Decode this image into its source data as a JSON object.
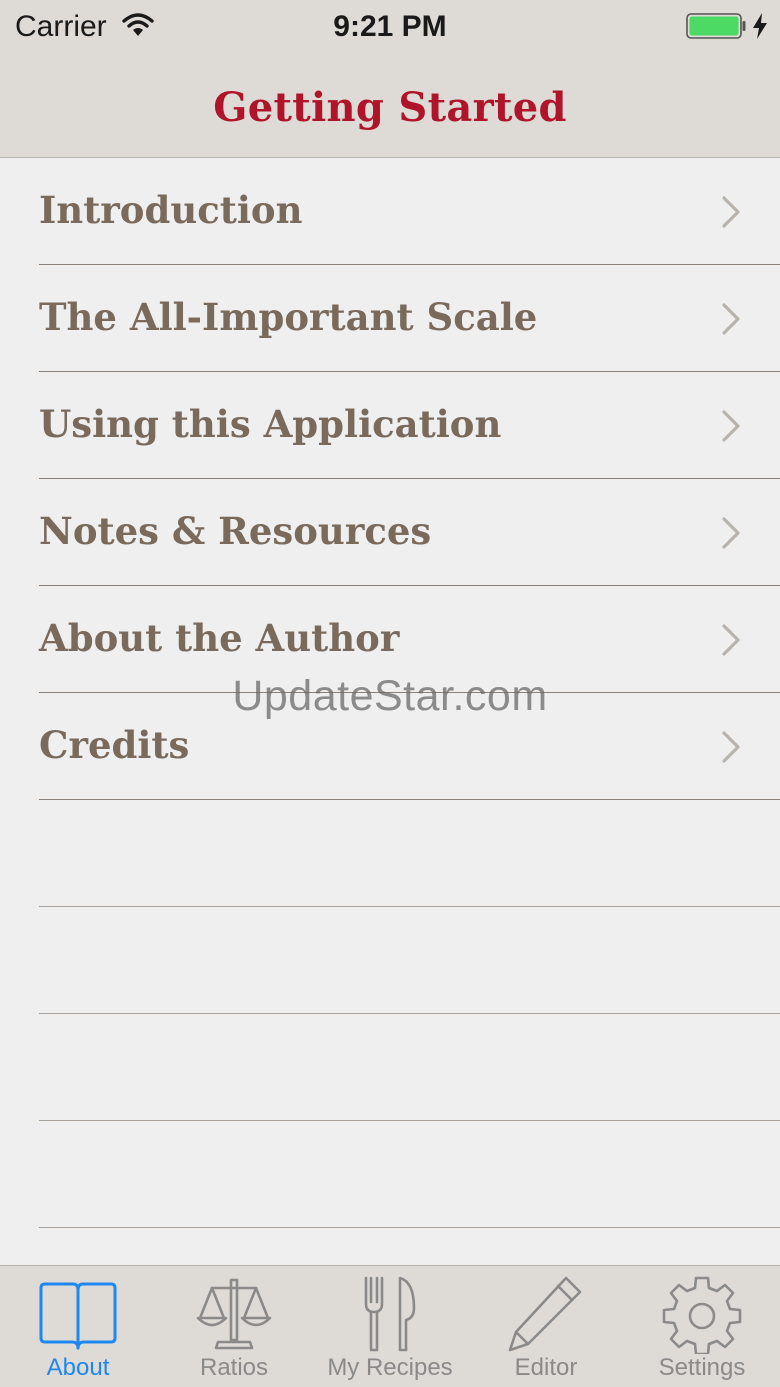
{
  "status_bar": {
    "carrier": "Carrier",
    "time": "9:21 PM",
    "battery_color": "#4cd964"
  },
  "nav": {
    "title": "Getting Started",
    "title_color": "#b0142a"
  },
  "menu": {
    "items": [
      {
        "label": "Introduction"
      },
      {
        "label": "The All-Important Scale"
      },
      {
        "label": "Using this Application"
      },
      {
        "label": "Notes & Resources"
      },
      {
        "label": "About the Author"
      },
      {
        "label": "Credits"
      }
    ]
  },
  "watermark": "UpdateStar.com",
  "tabbar": {
    "active_color": "#1e88f0",
    "tabs": [
      {
        "label": "About",
        "icon": "book-icon",
        "active": true
      },
      {
        "label": "Ratios",
        "icon": "scale-icon",
        "active": false
      },
      {
        "label": "My Recipes",
        "icon": "fork-knife-icon",
        "active": false
      },
      {
        "label": "Editor",
        "icon": "pencil-icon",
        "active": false
      },
      {
        "label": "Settings",
        "icon": "gear-icon",
        "active": false
      }
    ]
  }
}
